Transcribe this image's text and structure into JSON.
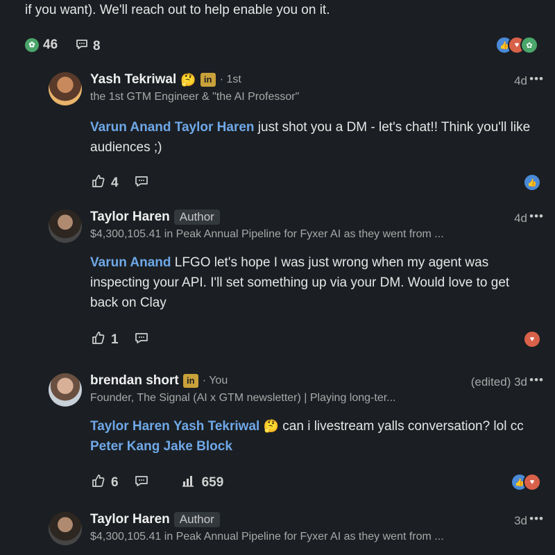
{
  "post": {
    "tail_text": "if you want). We'll reach out to help enable you on it.",
    "reaction_count": "46",
    "comment_count": "8"
  },
  "comments": [
    {
      "name": "Yash Tekriwal",
      "emoji": "🤔",
      "li_badge": "in",
      "degree": "· 1st",
      "headline": "the 1st GTM Engineer & \"the AI Professor\"",
      "time": "4d",
      "more": "•••",
      "mentions": [
        "Varun Anand",
        "Taylor Haren"
      ],
      "text": " just shot you a DM - let's chat!! Think you'll like audiences ;)",
      "likes": "4"
    },
    {
      "name": "Taylor Haren",
      "author_badge": "Author",
      "headline": "$4,300,105.41 in Peak Annual Pipeline for Fyxer AI as they went from ...",
      "time": "4d",
      "more": "•••",
      "mentions": [
        "Varun Anand"
      ],
      "text": " LFGO let's hope I was just wrong when my agent was inspecting your API. I'll set something up via your DM. Would love to get back on Clay",
      "likes": "1"
    },
    {
      "name": "brendan short",
      "li_badge": "in",
      "degree": "· You",
      "headline": "Founder, The Signal (AI x GTM newsletter) | Playing long-ter...",
      "time": "(edited) 3d",
      "more": "•••",
      "mentions": [
        "Taylor Haren",
        "Yash Tekriwal"
      ],
      "emoji": "🤔",
      "text": " can i livestream yalls conversation? lol cc ",
      "mentions2": [
        "Peter Kang",
        "Jake Block"
      ],
      "likes": "6",
      "impressions": "659"
    },
    {
      "name": "Taylor Haren",
      "author_badge": "Author",
      "headline": "$4,300,105.41 in Peak Annual Pipeline for Fyxer AI as they went from ...",
      "time": "3d",
      "more": "•••"
    }
  ]
}
